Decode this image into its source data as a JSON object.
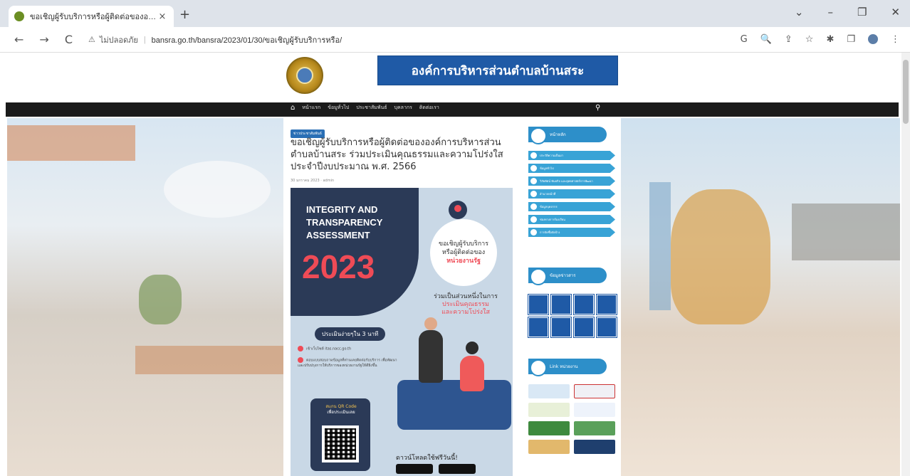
{
  "browser": {
    "tab_title": "ขอเชิญผู้รับบริการหรือผู้ติดต่อขององค์",
    "tab_close": "×",
    "new_tab": "+",
    "window_controls": [
      "⌄",
      "–",
      "❐",
      "✕"
    ],
    "nav": [
      "←",
      "→",
      "C"
    ],
    "security_label": "ไม่ปลอดภัย",
    "url": "bansra.go.th/bansra/2023/01/30/ขอเชิญผู้รับบริการหรือ/",
    "toolbar_icons": [
      "G",
      "🔍",
      "⇪",
      "☆",
      "✱",
      "❐"
    ]
  },
  "site": {
    "banner": "องค์การบริหารส่วนตำบลบ้านสระ",
    "menu": [
      "หน้าแรก",
      "ข้อมูทั่วไป",
      "ประชาสัมพันธ์",
      "บุคลากร",
      "ติดต่อเรา"
    ],
    "home_icon": "⌂",
    "search_icon": "⚲"
  },
  "post": {
    "category": "ข่าวประชาสัมพันธ์",
    "title": "ขอเชิญผู้รับบริการหรือผู้ติดต่อขององค์การบริหารส่วนตำบลบ้านสระ ร่วมประเมินคุณธรรมและความโปร่งใส ประจำปีงบประมาณ พ.ศ. 2566",
    "meta": "30 มกราคม 2023 · admin"
  },
  "poster": {
    "heading_line1": "INTEGRITY AND",
    "heading_line2": "TRANSPARENCY",
    "heading_line3": "ASSESSMENT",
    "year": "2023",
    "bubble_line1": "ขอเชิญผู้รับบริการ",
    "bubble_line2": "หรือผู้ติดต่อของ",
    "bubble_line3": "หน่วยงานรัฐ",
    "right_line1": "ร่วมเป็นส่วนหนึ่งในการ",
    "right_line2": "ประเมินคุณธรรม",
    "right_line3": "และความโปร่งใส",
    "pill": "ประเมินง่ายๆใน 3 นาที",
    "step1": "เข้าเว็บไซต์ itas.nacc.go.th",
    "step2": "ตอบแบบสอบถามข้อมูลที่ท่านเคยติดต่อรับบริการ เพื่อพัฒนาและปรับปรุงการให้บริการของหน่วยงานรัฐให้ดียิ่งขึ้น",
    "qr_line1": "สแกน QR Code",
    "qr_line2": "เพื่อประเมินเลย",
    "download": "ดาวน์โหลดใช้ฟรีวันนี้!"
  },
  "sidebar": {
    "section1": "หน้าหลัก",
    "links": [
      "ประวัติความเป็นมา",
      "ข้อมูลทั่วไป",
      "วิสัยทัศน์ พันธกิจ และยุทธศาสตร์การพัฒนา",
      "อำนาจหน้าที่",
      "ข้อมูลบุคลากร",
      "ช่องทางการร้องเรียน",
      "การจัดซื้อจัดจ้าง"
    ],
    "section2": "ข้อมูลข่าวสาร",
    "section3": "Link หน่วยงาน",
    "link_colors": [
      "#d9e8f5",
      "#f0f0f5",
      "#e8f0d8",
      "#eef3fb",
      "#3e8a3e",
      "#5aa05a",
      "#e2b86c",
      "#1f3f6e"
    ]
  },
  "colors": {
    "banner": "#1f5aa6",
    "accent": "#2d8fc9",
    "poster_dark": "#2b3a57",
    "poster_red": "#ef4b56"
  }
}
